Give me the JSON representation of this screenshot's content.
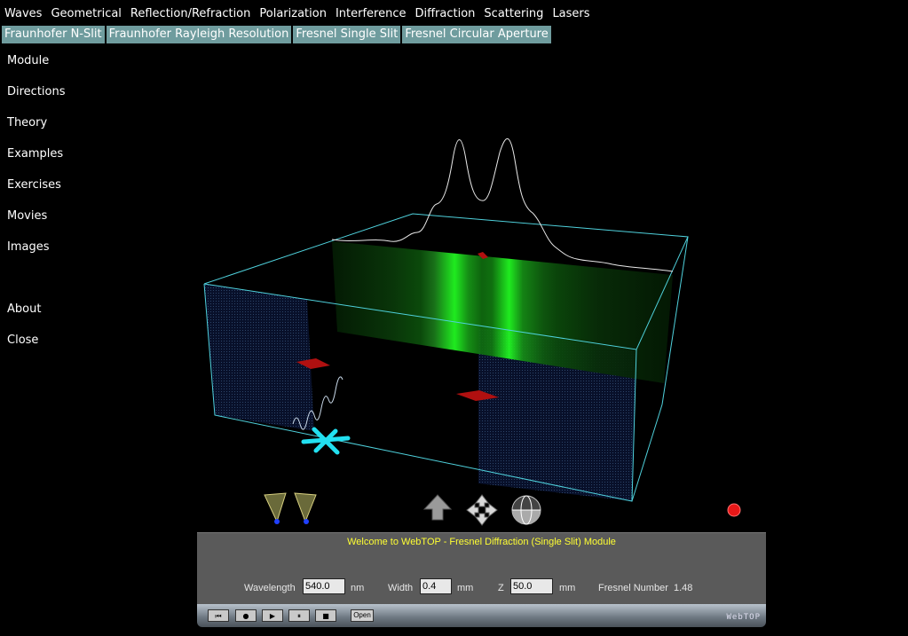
{
  "topnav": [
    "Waves",
    "Geometrical",
    "Reflection/Refraction",
    "Polarization",
    "Interference",
    "Diffraction",
    "Scattering",
    "Lasers"
  ],
  "subnav": [
    "Fraunhofer N-Slit",
    "Fraunhofer Rayleigh Resolution",
    "Fresnel Single Slit",
    "Fresnel Circular Aperture"
  ],
  "sidebar": [
    "Module",
    "Directions",
    "Theory",
    "Examples",
    "Exercises",
    "Movies",
    "Images",
    "About",
    "Close"
  ],
  "panel": {
    "welcome": "Welcome to WebTOP - Fresnel Diffraction (Single Slit) Module",
    "wavelength_label": "Wavelength",
    "wavelength_value": "540.0",
    "wavelength_unit": "nm",
    "width_label": "Width",
    "width_value": "0.4",
    "width_unit": "mm",
    "z_label": "Z",
    "z_value": "50.0",
    "z_unit": "mm",
    "fresnel_label": "Fresnel Number",
    "fresnel_value": "1.48"
  },
  "transport": {
    "rewind": "⏮",
    "record": "●",
    "play": "▶",
    "pause": "⏸",
    "stop": "■",
    "open": "Open",
    "brand": "WebTOP"
  },
  "icons": [
    "viewpoint-left-icon",
    "viewpoint-right-icon",
    "pan-up-icon",
    "move-cross-icon",
    "rotate-sphere-icon",
    "red-dot-icon"
  ],
  "colors": {
    "accent": "#6f9c9e",
    "wireframe": "#4fd1dc",
    "screen_glow": "#22ff22",
    "welcome_text": "#ffff33"
  }
}
